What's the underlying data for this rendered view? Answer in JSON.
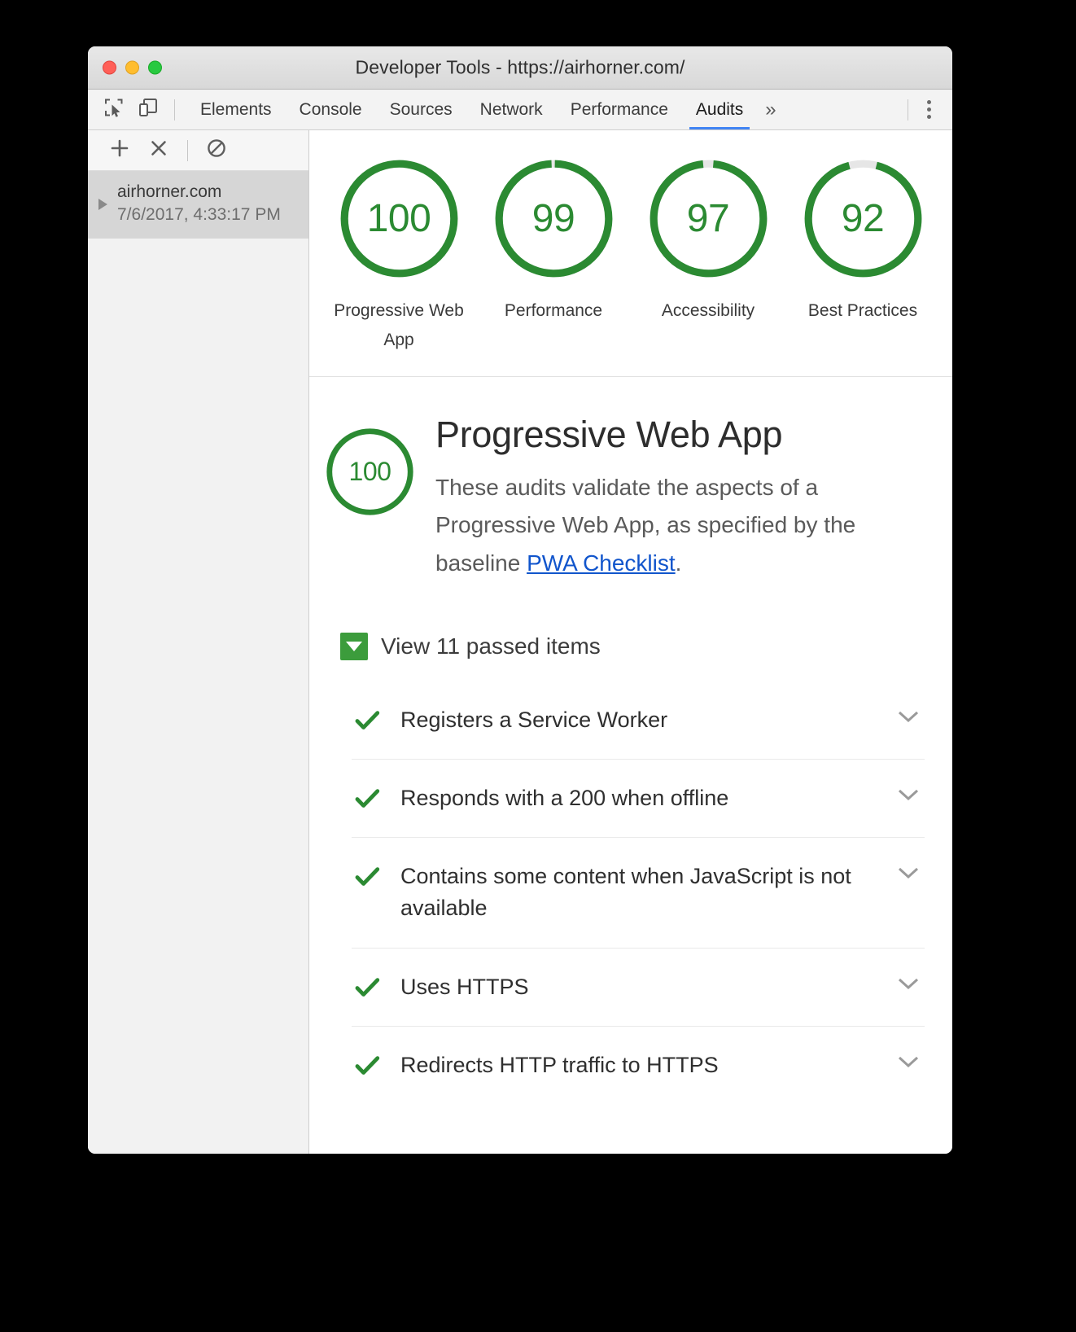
{
  "window": {
    "title": "Developer Tools - https://airhorner.com/",
    "traffic_lights": [
      "close-red",
      "minimize-yellow",
      "maximize-green"
    ]
  },
  "tabstrip": {
    "tool_buttons": [
      {
        "name": "inspect-element-icon",
        "label": "Inspect element"
      },
      {
        "name": "device-toolbar-icon",
        "label": "Toggle device toolbar"
      }
    ],
    "tabs": [
      {
        "label": "Elements",
        "active": false
      },
      {
        "label": "Console",
        "active": false
      },
      {
        "label": "Sources",
        "active": false
      },
      {
        "label": "Network",
        "active": false
      },
      {
        "label": "Performance",
        "active": false
      },
      {
        "label": "Audits",
        "active": true
      }
    ],
    "overflow_label": "»",
    "menu_icon": "kebab-menu-icon",
    "active_tab_underline_color": "#4285f4"
  },
  "sidebar": {
    "toolbar": [
      {
        "name": "add-audit-button",
        "icon": "plus-icon"
      },
      {
        "name": "delete-audit-button",
        "icon": "close-x-icon"
      },
      {
        "name": "clear-all-button",
        "icon": "no-entry-icon"
      }
    ],
    "runs": [
      {
        "host": "airhorner.com",
        "timestamp": "7/6/2017, 4:33:17 PM",
        "expanded": false,
        "selected": true
      }
    ]
  },
  "report": {
    "gauges": [
      {
        "score": "100",
        "label": "Progressive Web App",
        "percent": 100
      },
      {
        "score": "99",
        "label": "Performance",
        "percent": 99
      },
      {
        "score": "97",
        "label": "Accessibility",
        "percent": 97
      },
      {
        "score": "92",
        "label": "Best Practices",
        "percent": 92
      }
    ],
    "category": {
      "score": "100",
      "percent": 100,
      "title": "Progressive Web App",
      "description_before": "These audits validate the aspects of a Progressive Web App, as specified by the baseline ",
      "link_text": "PWA Checklist",
      "description_after": "."
    },
    "passed_toggle": {
      "label": "View 11 passed items",
      "expanded": true,
      "count": 11
    },
    "audits": [
      {
        "title": "Registers a Service Worker",
        "status": "pass"
      },
      {
        "title": "Responds with a 200 when offline",
        "status": "pass"
      },
      {
        "title": "Contains some content when JavaScript is not available",
        "status": "pass"
      },
      {
        "title": "Uses HTTPS",
        "status": "pass"
      },
      {
        "title": "Redirects HTTP traffic to HTTPS",
        "status": "pass"
      }
    ]
  },
  "colors": {
    "pass_green": "#2b8a32",
    "toggle_green": "#3c9c3c",
    "link_blue": "#1155cc",
    "accent_blue": "#4285f4",
    "ring_track": "#e6e6e6"
  }
}
